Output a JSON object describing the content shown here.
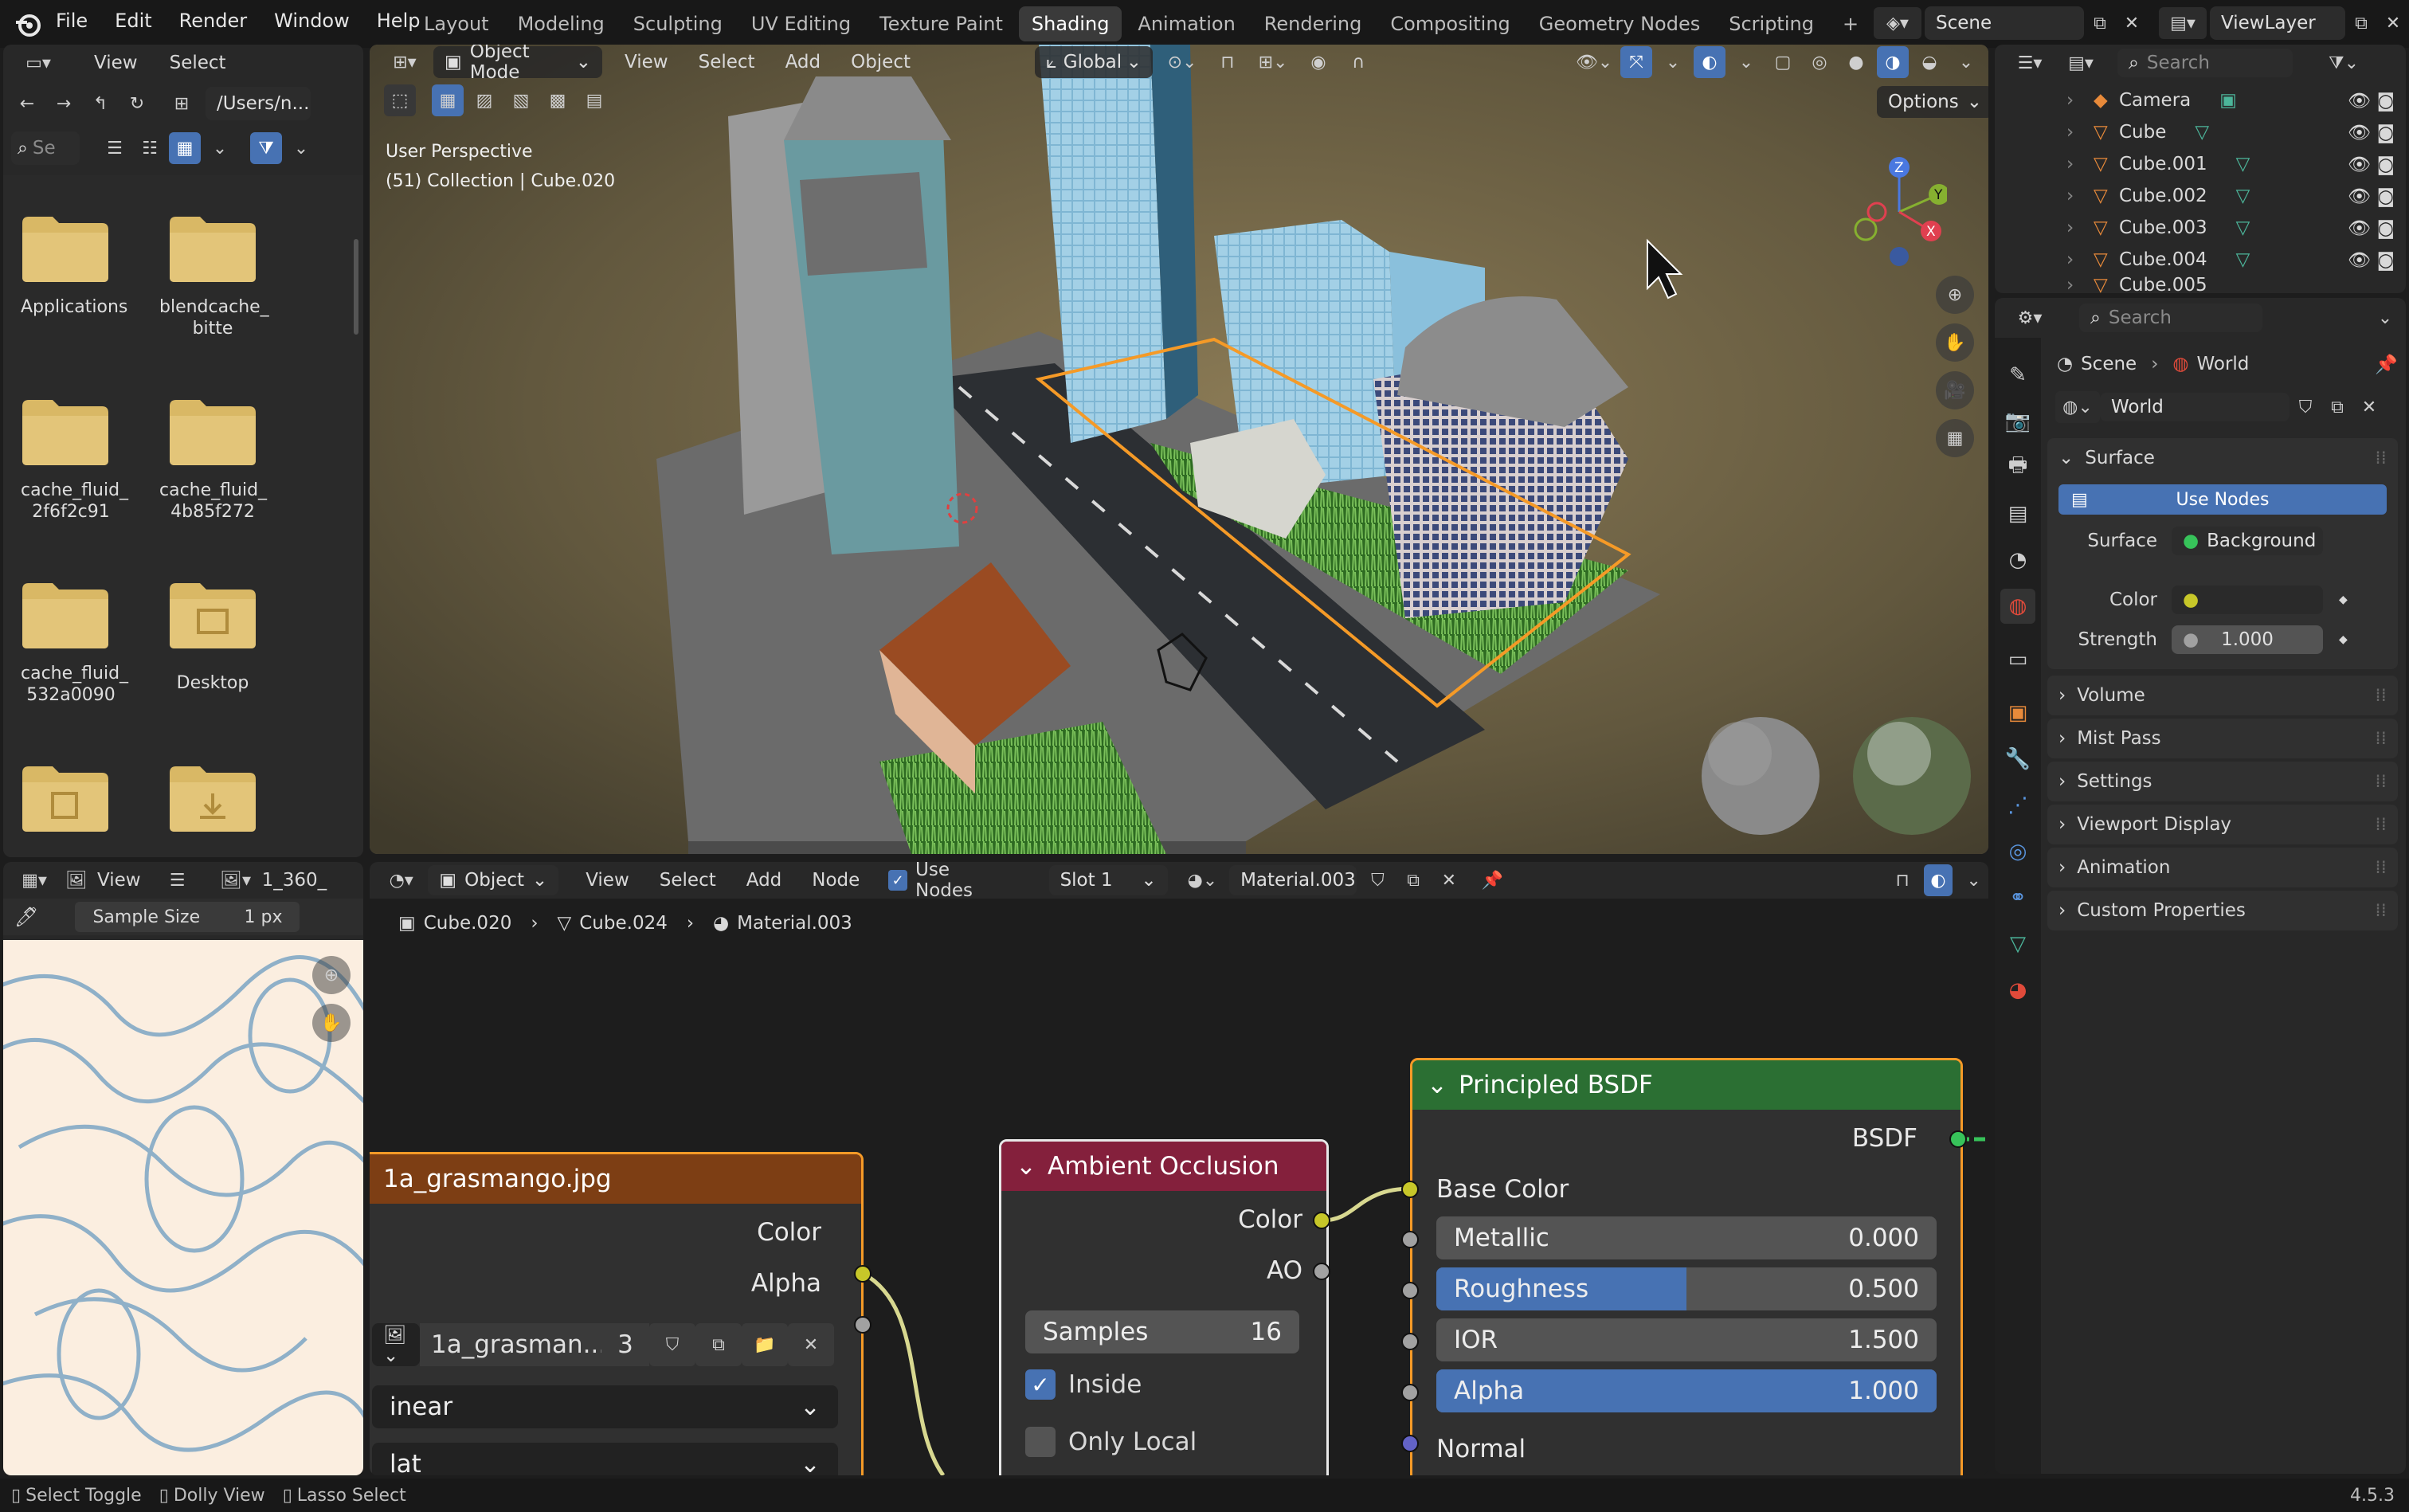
{
  "app": {
    "version": "4.5.3"
  },
  "menu": [
    "File",
    "Edit",
    "Render",
    "Window",
    "Help"
  ],
  "workspaces": [
    "Layout",
    "Modeling",
    "Sculpting",
    "UV Editing",
    "Texture Paint",
    "Shading",
    "Animation",
    "Rendering",
    "Compositing",
    "Geometry Nodes",
    "Scripting"
  ],
  "active_workspace": "Shading",
  "scene_name": "Scene",
  "view_layer": "ViewLayer",
  "file_browser": {
    "menu": [
      "View",
      "Select"
    ],
    "path": "/Users/n...",
    "search_placeholder": "Se",
    "items": [
      {
        "name": "Applications",
        "icon": "folder-icon"
      },
      {
        "name": "blendcache_bitte",
        "line1": "blendcache_",
        "line2": "bitte",
        "icon": "folder-icon"
      },
      {
        "name": "cache_fluid_2f6f2c91",
        "line1": "cache_fluid_",
        "line2": "2f6f2c91",
        "icon": "folder-icon"
      },
      {
        "name": "cache_fluid_4b85f272",
        "line1": "cache_fluid_",
        "line2": "4b85f272",
        "icon": "folder-icon"
      },
      {
        "name": "cache_fluid_532a0090",
        "line1": "cache_fluid_",
        "line2": "532a0090",
        "icon": "folder-icon"
      },
      {
        "name": "Desktop",
        "icon": "desktop-folder-icon"
      }
    ]
  },
  "viewport": {
    "mode": "Object Mode",
    "menu": [
      "View",
      "Select",
      "Add",
      "Object"
    ],
    "orientation": "Global",
    "options_label": "Options",
    "info_line1": "User Perspective",
    "info_line2": "(51) Collection | Cube.020"
  },
  "outliner": {
    "search_placeholder": "Search",
    "items": [
      "Camera",
      "Cube",
      "Cube.001",
      "Cube.002",
      "Cube.003",
      "Cube.004",
      "Cube.005"
    ]
  },
  "properties": {
    "search_placeholder": "Search",
    "breadcrumb": [
      "Scene",
      "World"
    ],
    "world_name": "World",
    "surface_panel": "Surface",
    "use_nodes_label": "Use Nodes",
    "surface_label": "Surface",
    "surface_value": "Background",
    "color_label": "Color",
    "strength_label": "Strength",
    "strength_value": "1.000",
    "collapsed_panels": [
      "Volume",
      "Mist Pass",
      "Settings",
      "Viewport Display",
      "Animation",
      "Custom Properties"
    ]
  },
  "image_editor": {
    "view_label": "View",
    "image_name": "1_360_",
    "sample_size_label": "Sample Size",
    "sample_size_value": "1 px"
  },
  "node_editor": {
    "type_label": "Object",
    "menu": [
      "View",
      "Select",
      "Add",
      "Node"
    ],
    "use_nodes_label": "Use Nodes",
    "slot": "Slot 1",
    "material": "Material.003",
    "breadcrumb": [
      "Cube.020",
      "Cube.024",
      "Material.003"
    ],
    "image_node": {
      "title": "1a_grasmango.jpg",
      "outputs": [
        "Color",
        "Alpha"
      ],
      "image_field": "1a_grasman...",
      "users": "3",
      "interpolation": "inear",
      "projection": "lat"
    },
    "ao_node": {
      "title": "Ambient Occlusion",
      "outputs": [
        "Color",
        "AO"
      ],
      "samples_label": "Samples",
      "samples_value": "16",
      "inside_label": "Inside",
      "only_local_label": "Only Local"
    },
    "bsdf_node": {
      "title": "Principled BSDF",
      "output": "BSDF",
      "base_color_label": "Base Color",
      "metallic_label": "Metallic",
      "metallic_value": "0.000",
      "roughness_label": "Roughness",
      "roughness_value": "0.500",
      "roughness": 0.5,
      "ior_label": "IOR",
      "ior_value": "1.500",
      "alpha_label": "Alpha",
      "alpha_value": "1.000",
      "alpha": 1.0,
      "normal_label": "Normal"
    }
  },
  "statusbar": [
    "Select Toggle",
    "Dolly View",
    "Lasso Select"
  ],
  "colors": {
    "accent": "#4772b3",
    "selection_orange": "#f59a27",
    "image_node_header": "#7d3e14",
    "ao_node_header": "#84203c",
    "bsdf_node_header": "#2b6f33",
    "socket_yellow": "#c7c729",
    "socket_gray": "#a1a1a1",
    "socket_purple": "#6363c7",
    "socket_green": "#37c35a"
  }
}
